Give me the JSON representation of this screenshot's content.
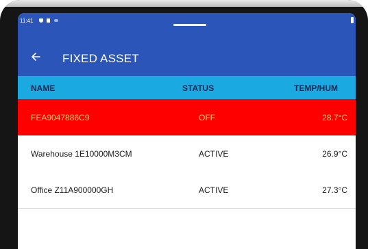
{
  "status_bar": {
    "time": "11:41"
  },
  "header": {
    "title": "FIXED ASSET"
  },
  "columns": {
    "name": "NAME",
    "status": "STATUS",
    "temp_hum": "TEMP/HUM"
  },
  "rows": [
    {
      "name": "FEA9047886C9",
      "status": "OFF",
      "temp": "28.7°C",
      "bg": "#ff0000",
      "fg": "#f6c96f"
    },
    {
      "name": "Warehouse 1E10000M3CM",
      "status": "ACTIVE",
      "temp": "26.9°C",
      "bg": "#ffffff",
      "fg": "#1a1a1a"
    },
    {
      "name": "Office Z11A900000GH",
      "status": "ACTIVE",
      "temp": "27.3°C",
      "bg": "#ffffff",
      "fg": "#1a1a1a"
    }
  ],
  "colors": {
    "app_bar": "#2b55b8",
    "table_header": "#1aa9e0",
    "alarm_row": "#ff0000"
  },
  "icons": {
    "back": "back-arrow-icon",
    "battery": "battery-icon"
  }
}
